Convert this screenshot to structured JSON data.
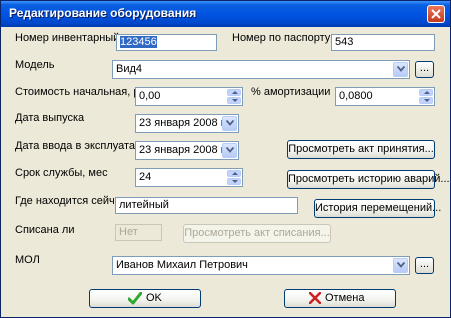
{
  "window": {
    "title": "Редактирование оборудования"
  },
  "fields": {
    "inventory_number": {
      "label": "Номер инвентарный",
      "value": "123456"
    },
    "passport_number": {
      "label": "Номер по  паспорту",
      "value": "543"
    },
    "model": {
      "label": "Модель",
      "value": "Вид4",
      "browse_label": "..."
    },
    "initial_cost": {
      "label": "Стоимость начальная, руб.",
      "value": "0,00"
    },
    "depreciation": {
      "label": "% амортизации",
      "value": "0,0800"
    },
    "release_date": {
      "label": "Дата выпуска",
      "value": "23   января   2008 г."
    },
    "commission_date": {
      "label": "Дата ввода в эксплуатацию",
      "value": "23   января   2008 г."
    },
    "service_life": {
      "label": "Срок службы, мес",
      "value": "24"
    },
    "location": {
      "label": "Где находится сейчас",
      "value": "литейный"
    },
    "written_off": {
      "label": "Списана ли",
      "value": "Нет"
    },
    "mol": {
      "label": "МОЛ",
      "value": "Иванов Михаил Петрович",
      "browse_label": "..."
    }
  },
  "buttons": {
    "view_acceptance_act": "Просмотреть акт принятия...",
    "view_accident_history": "Просмотреть историю аварий...",
    "movement_history": "История перемещений...",
    "view_writeoff_act": "Просмотреть акт списания...",
    "ok": "OK",
    "cancel": "Отмена"
  },
  "colors": {
    "titlebar": "#0054e3",
    "dialog_bg": "#ece9d8",
    "ok_icon": "#2ea82e",
    "cancel_icon": "#cc2222"
  }
}
